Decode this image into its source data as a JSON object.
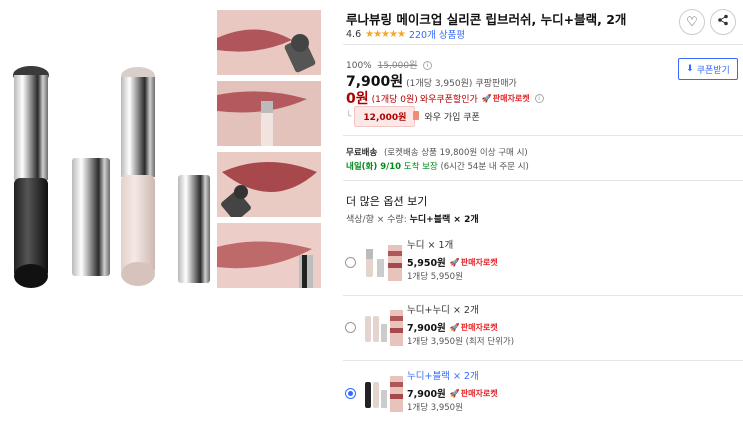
{
  "product": {
    "title": "루나뷰링 메이크업 실리콘 립브러쉬, 누디+블랙, 2개",
    "rating": "4.6",
    "stars": "★★★★★",
    "review_count": "220개 상품평"
  },
  "actions": {
    "wish_icon": "heart-icon",
    "share_icon": "share-icon"
  },
  "pricing": {
    "discount_pct": "100%",
    "original_price": "15,000원",
    "price": "7,900원",
    "unit_price": "(1개당 3,950원)",
    "price_type": "쿠팡판매가",
    "member_price": "0원",
    "member_unit": "(1개당 0원)",
    "member_label": "와우쿠폰할인가",
    "rocket_badge": "판매자로켓",
    "coupon_button": "쿠폰받기",
    "cash_amount": "12,000원",
    "cash_label": "와우 가입 쿠폰"
  },
  "shipping": {
    "free_label": "무료배송",
    "free_detail": "(로켓배송 상품 19,800원 이상 구매 시)",
    "arrival": "내일(화) 9/10",
    "arrival_suffix": "도착 보장",
    "arrival_detail": "(6시간 54분 내 주문 시)"
  },
  "options": {
    "title": "더 많은 옵션 보기",
    "summary_prefix": "색상/향 × 수량:",
    "summary_value": "누디+블랙 × 2개",
    "items": [
      {
        "name": "누디 × 1개",
        "price": "5,950원",
        "badge": "판매자로켓",
        "per_unit": "1개당 5,950원",
        "note": "",
        "selected": false
      },
      {
        "name": "누디+누디 × 2개",
        "price": "7,900원",
        "badge": "판매자로켓",
        "per_unit": "1개당 3,950원",
        "note": "(최저 단위가)",
        "selected": false
      },
      {
        "name": "누디+블랙 × 2개",
        "price": "7,900원",
        "badge": "판매자로켓",
        "per_unit": "1개당 3,950원",
        "note": "",
        "selected": true
      }
    ]
  },
  "colors": {
    "accent": "#346aff",
    "sale_red": "#ae0000",
    "rocket_red": "#e52528",
    "star": "#f5a623",
    "green": "#00891a"
  }
}
